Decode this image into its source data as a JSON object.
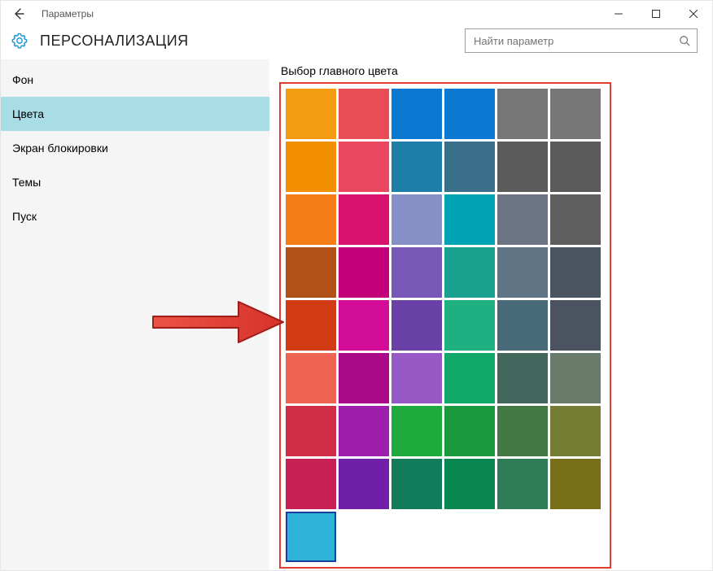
{
  "window": {
    "title": "Параметры"
  },
  "header": {
    "heading": "ПЕРСОНАЛИЗАЦИЯ"
  },
  "search": {
    "placeholder": "Найти параметр"
  },
  "sidebar": {
    "items": [
      {
        "label": "Фон",
        "selected": false
      },
      {
        "label": "Цвета",
        "selected": true
      },
      {
        "label": "Экран блокировки",
        "selected": false
      },
      {
        "label": "Темы",
        "selected": false
      },
      {
        "label": "Пуск",
        "selected": false
      }
    ]
  },
  "section": {
    "title": "Выбор главного цвета"
  },
  "color_grid": {
    "columns": 6,
    "selected_index": 48,
    "colors": [
      "#f39c12",
      "#e84c54",
      "#0b78d1",
      "#0b78d1",
      "#777777",
      "#777777",
      "#f18f01",
      "#e8475f",
      "#1d7ea8",
      "#3a6f8a",
      "#5b5b5b",
      "#5b5b5b",
      "#f47d18",
      "#d8126e",
      "#8690c7",
      "#00a3b4",
      "#6c7483",
      "#5f5f5f",
      "#b15017",
      "#c3007a",
      "#7858b6",
      "#19a08f",
      "#5f7485",
      "#4b5560",
      "#d13c14",
      "#d10d97",
      "#6940a6",
      "#1fb082",
      "#486a78",
      "#4b5360",
      "#ee6352",
      "#aa0a88",
      "#9759c6",
      "#0fa868",
      "#44675d",
      "#6a7a6b",
      "#cf2d45",
      "#9d1fab",
      "#1da93c",
      "#1a9a3d",
      "#437945",
      "#757d34",
      "#c72054",
      "#6f1fa8",
      "#127b59",
      "#098750",
      "#2f7c58",
      "#776e17",
      "#2eb3d9"
    ]
  }
}
